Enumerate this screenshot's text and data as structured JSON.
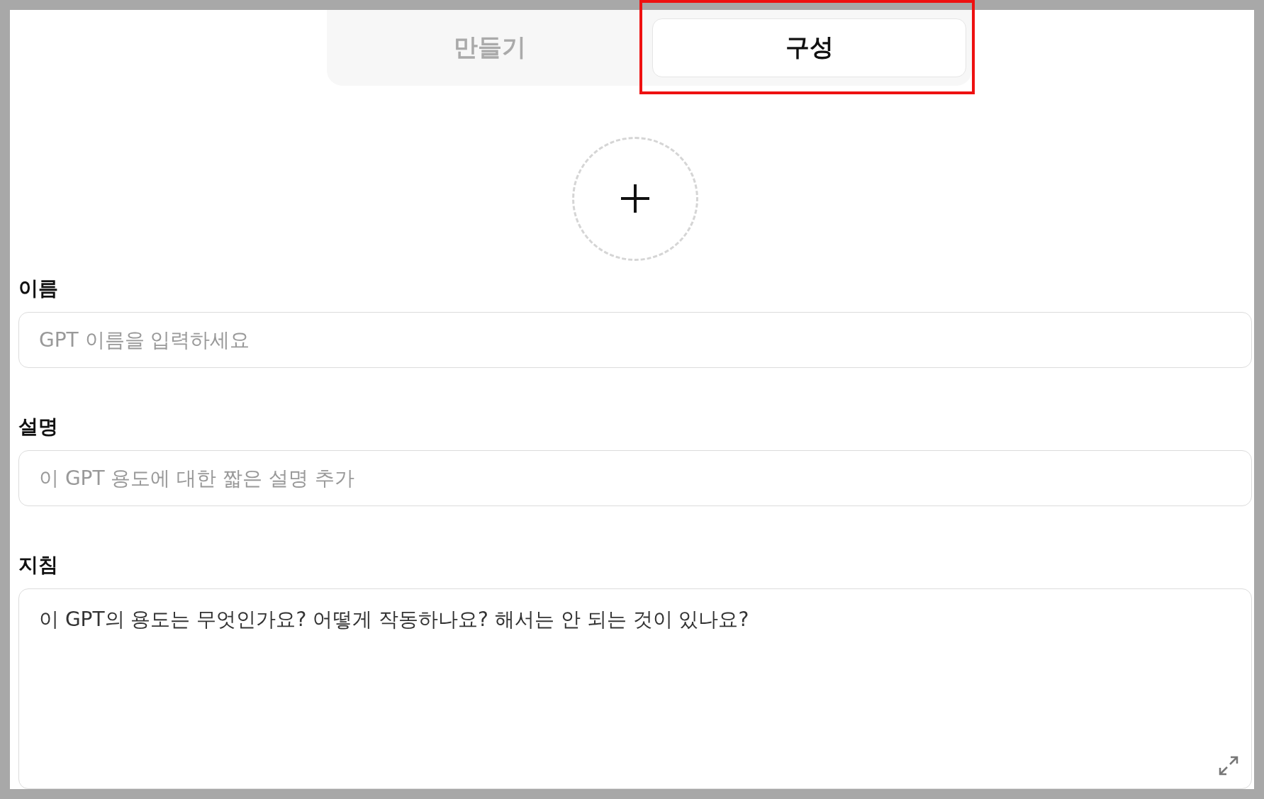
{
  "tabs": [
    {
      "label": "만들기",
      "selected": false
    },
    {
      "label": "구성",
      "selected": true,
      "highlighted": true
    }
  ],
  "fields": [
    {
      "kind": "input",
      "label": "이름",
      "placeholder": "GPT 이름을 입력하세요"
    },
    {
      "kind": "input",
      "label": "설명",
      "placeholder": "이 GPT 용도에 대한 짧은 설명 추가"
    },
    {
      "kind": "textarea",
      "label": "지침",
      "value": "이 GPT의 용도는 무엇인가요? 어떻게 작동하나요? 해서는 안 되는 것이 있나요?"
    }
  ]
}
